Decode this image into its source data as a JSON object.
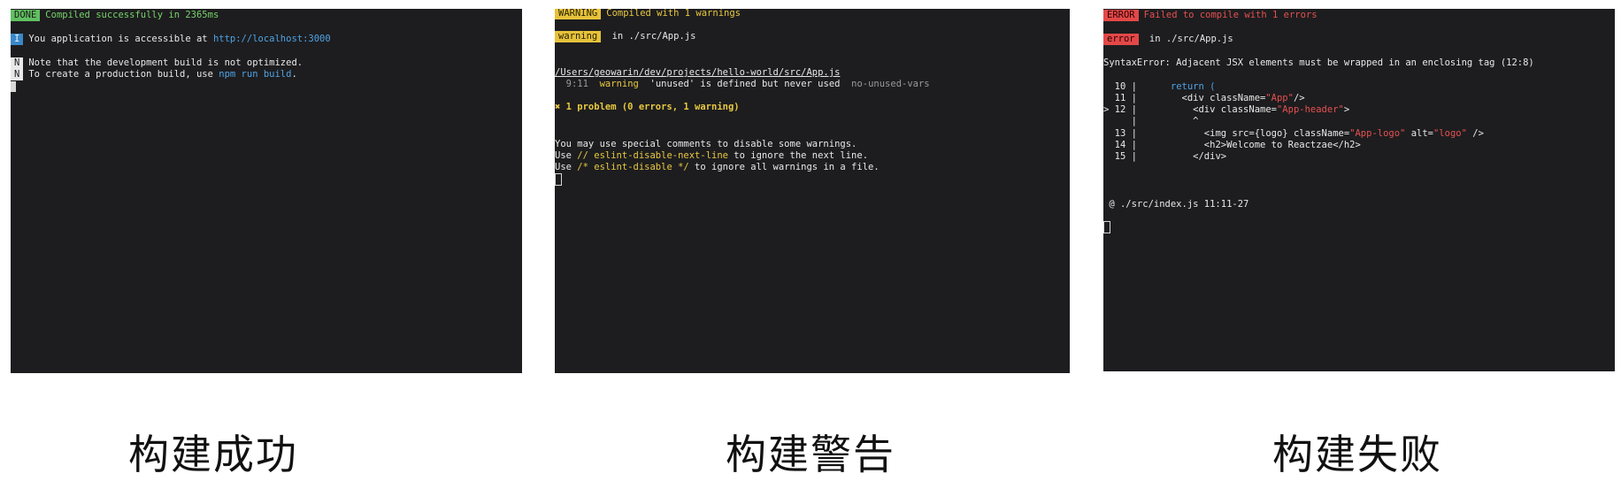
{
  "panels": [
    {
      "caption": "构建成功",
      "done_badge": "DONE",
      "done_text": "Compiled successfully in 2365ms",
      "info_badge": "I",
      "info_text": "You application is accessible at ",
      "info_url": "http://localhost:3000",
      "note_badge": "N",
      "note_line1": "Note that the development build is not optimized.",
      "note_line2_prefix": "To create a production build, use ",
      "note_cmd": "npm run build",
      "note_line2_suffix": "."
    },
    {
      "caption": "构建警告",
      "warning_badge": "WARNING",
      "warning_text": "Compiled with 1 warnings",
      "warning_badge2": "warning",
      "in_file": " in ./src/App.js",
      "path": "/Users/geowarin/dev/projects/hello-world/src/App.js",
      "location": "9:11",
      "level": "warning",
      "message": "'unused' is defined but never used",
      "rule": "no-unused-vars",
      "problem": "✖ 1 problem (0 errors, 1 warning)",
      "hint1": "You may use special comments to disable some warnings.",
      "hint2_prefix": "Use ",
      "hint2_code": "// eslint-disable-next-line",
      "hint2_suffix": " to ignore the next line.",
      "hint3_prefix": "Use ",
      "hint3_code": "/* eslint-disable */",
      "hint3_suffix": " to ignore all warnings in a file."
    },
    {
      "caption": "构建失败",
      "error_badge": "ERROR",
      "error_text": "Failed to compile with 1 errors",
      "error_badge2": "error",
      "in_file": " in ./src/App.js",
      "syntax_error": "SyntaxError: Adjacent JSX elements must be wrapped in an enclosing tag (12:8)",
      "code": {
        "l10_num": "  10 |",
        "l10": "      return (",
        "l11_num": "  11 |",
        "l11_a": "        <div className=",
        "l11_s": "\"App\"",
        "l11_b": "/>",
        "l12_num": "> 12 |",
        "l12_a": "          <div className=",
        "l12_s": "\"App-header\"",
        "l12_b": ">",
        "lc_num": "     |",
        "lc": "          ^",
        "l13_num": "  13 |",
        "l13_a": "            <img src={logo} className=",
        "l13_s1": "\"App-logo\"",
        "l13_b": " alt=",
        "l13_s2": "\"logo\"",
        "l13_c": " />",
        "l14_num": "  14 |",
        "l14": "            <h2>Welcome to Reactzae</h2>",
        "l15_num": "  15 |",
        "l15": "          </div>"
      },
      "at": " @ ./src/index.js 11:11-27"
    }
  ]
}
